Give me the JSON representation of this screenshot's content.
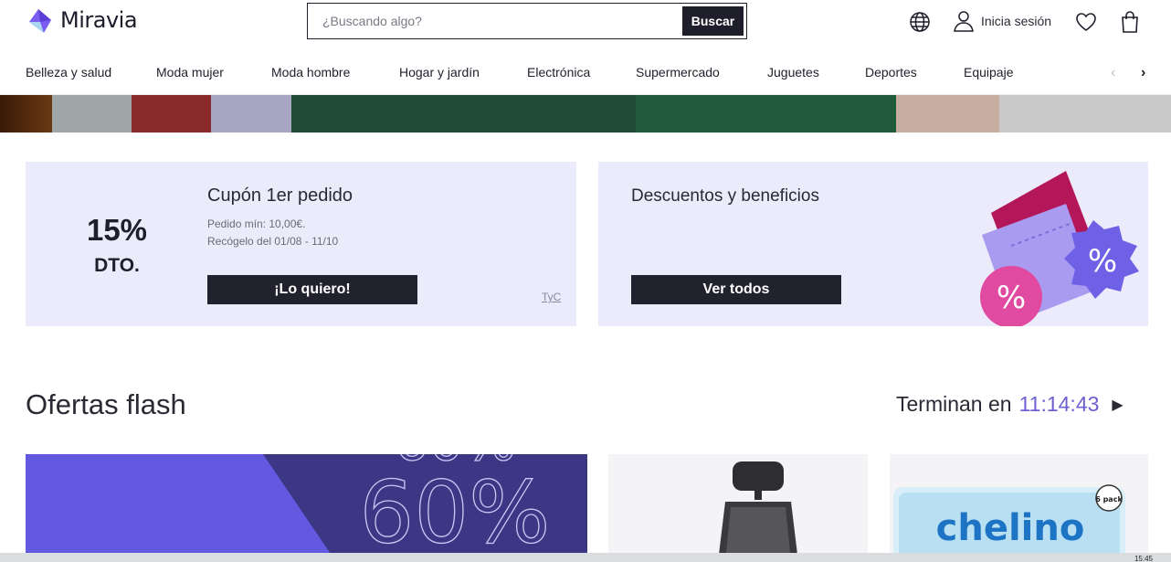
{
  "brand": {
    "name": "Miravia"
  },
  "search": {
    "placeholder": "¿Buscando algo?",
    "button": "Buscar"
  },
  "header": {
    "login_label": "Inicia sesión",
    "icons": [
      "globe-icon",
      "user-icon",
      "heart-icon",
      "bag-icon"
    ]
  },
  "nav": {
    "items": [
      "Belleza y salud",
      "Moda mujer",
      "Moda hombre",
      "Hogar y jardín",
      "Electrónica",
      "Supermercado",
      "Juguetes",
      "Deportes",
      "Equipaje"
    ]
  },
  "coupon": {
    "percent": "15%",
    "dto": "DTO.",
    "title": "Cupón 1er pedido",
    "min_order": "Pedido mín: 10,00€.",
    "dates": "Recógelo del 01/08 - 11/10",
    "button": "¡Lo quiero!",
    "terms": "TyC"
  },
  "benefits": {
    "title": "Descuentos y beneficios",
    "button": "Ver todos"
  },
  "flash": {
    "title": "Ofertas flash",
    "ends_label": "Terminan en",
    "time": "11:14:43"
  },
  "products": {
    "promo_text": "60%",
    "diaper_brand": "chelino",
    "diaper_pack": "6 pack"
  },
  "taskbar": {
    "clock": "15:45"
  },
  "colors": {
    "accent": "#6c5fd0",
    "dark": "#1f1f2b",
    "card_bg": "#ebebfb"
  }
}
